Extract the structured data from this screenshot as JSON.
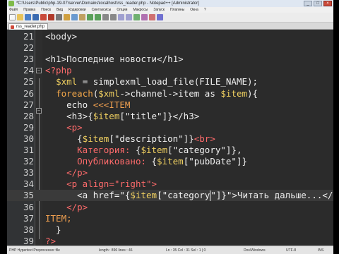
{
  "window": {
    "title": "*C:\\Users\\Public\\php-19-07\\server\\Domains\\localhost\\rss_reader.php - Notepad++ [Administrator]",
    "controls": [
      "_",
      "□",
      "×"
    ]
  },
  "menu": [
    "Файл",
    "Правка",
    "Поиск",
    "Вид",
    "Кодировки",
    "Синтаксисы",
    "Опции",
    "Макросы",
    "Запуск",
    "Плагины",
    "Окна",
    "?"
  ],
  "tab": {
    "label": "rss_reader.php"
  },
  "editor": {
    "lines": [
      {
        "num": "21",
        "parts": [
          [
            "t-tag",
            "<body>"
          ]
        ]
      },
      {
        "num": "22",
        "parts": []
      },
      {
        "num": "23",
        "parts": [
          [
            "t-tag",
            "<h1>Последние новости</h1>"
          ]
        ]
      },
      {
        "num": "24",
        "parts": [
          [
            "t-php",
            "<?php"
          ]
        ]
      },
      {
        "num": "25",
        "parts": [
          [
            "t-plain",
            "  "
          ],
          [
            "t-var",
            "$xml"
          ],
          [
            "t-plain",
            " = simplexml_load_file(FILE_NAME);"
          ]
        ]
      },
      {
        "num": "26",
        "parts": [
          [
            "t-plain",
            "  "
          ],
          [
            "t-kw",
            "foreach"
          ],
          [
            "t-plain",
            "("
          ],
          [
            "t-var",
            "$xml"
          ],
          [
            "t-plain",
            "->channel->item as "
          ],
          [
            "t-var",
            "$item"
          ],
          [
            "t-plain",
            "){"
          ]
        ]
      },
      {
        "num": "27",
        "parts": [
          [
            "t-plain",
            "    echo "
          ],
          [
            "t-heredoc",
            "<<<ITEM"
          ]
        ]
      },
      {
        "num": "28",
        "parts": [
          [
            "t-plain",
            "    <h3>{"
          ],
          [
            "t-var",
            "$item"
          ],
          [
            "t-plain",
            "[\"title\"]}</h3>"
          ]
        ]
      },
      {
        "num": "29",
        "parts": [
          [
            "t-plain",
            "    "
          ],
          [
            "t-attr",
            "<p>"
          ]
        ]
      },
      {
        "num": "30",
        "parts": [
          [
            "t-plain",
            "      {"
          ],
          [
            "t-var",
            "$item"
          ],
          [
            "t-plain",
            "[\"description\"]}"
          ],
          [
            "t-attr",
            "<br>"
          ]
        ]
      },
      {
        "num": "31",
        "parts": [
          [
            "t-plain",
            "      "
          ],
          [
            "t-attr",
            "Категория: "
          ],
          [
            "t-plain",
            "{"
          ],
          [
            "t-var",
            "$item"
          ],
          [
            "t-plain",
            "[\"category\"]},"
          ]
        ]
      },
      {
        "num": "32",
        "parts": [
          [
            "t-plain",
            "      "
          ],
          [
            "t-attr",
            "Опубликовано: "
          ],
          [
            "t-plain",
            "{"
          ],
          [
            "t-var",
            "$item"
          ],
          [
            "t-plain",
            "[\"pubDate\"]}"
          ]
        ]
      },
      {
        "num": "33",
        "parts": [
          [
            "t-plain",
            "    "
          ],
          [
            "t-attr",
            "</p>"
          ]
        ]
      },
      {
        "num": "34",
        "parts": [
          [
            "t-plain",
            "    "
          ],
          [
            "t-attr",
            "<p align=\"right\">"
          ]
        ]
      },
      {
        "num": "35",
        "current": true,
        "parts": [
          [
            "t-plain",
            "      <a href=\"{"
          ],
          [
            "t-var",
            "$item"
          ],
          [
            "t-plain",
            "[\"category"
          ],
          [
            "cursor",
            ""
          ],
          [
            "t-plain",
            "\"]}\">Читать дальше...</a>"
          ]
        ]
      },
      {
        "num": "36",
        "parts": [
          [
            "t-plain",
            "    "
          ],
          [
            "t-attr",
            "</p>"
          ]
        ]
      },
      {
        "num": "37",
        "parts": [
          [
            "t-heredoc",
            "ITEM;"
          ]
        ]
      },
      {
        "num": "38",
        "parts": [
          [
            "t-plain",
            "  }"
          ]
        ]
      },
      {
        "num": "39",
        "parts": [
          [
            "t-php",
            "?>"
          ]
        ]
      }
    ]
  },
  "status": {
    "type": "PHP Hypertext Preprocessor file",
    "length": "length : 896   lines : 46",
    "position": "Ln : 35   Col : 31   Sel : 1 | 0",
    "eol": "Dos\\Windows",
    "encoding": "UTF-8",
    "mode": "INS"
  }
}
